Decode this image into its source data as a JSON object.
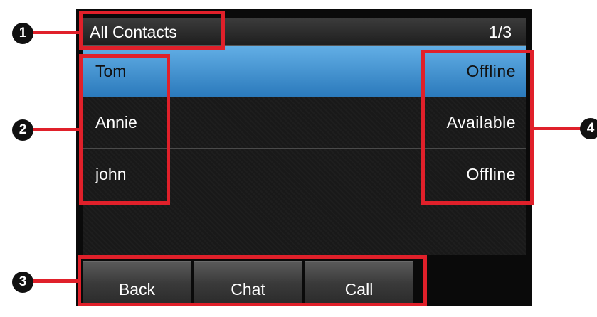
{
  "header": {
    "title": "All Contacts",
    "page_indicator": "1/3"
  },
  "contacts": [
    {
      "name": "Tom",
      "status": "Offline",
      "selected": true
    },
    {
      "name": "Annie",
      "status": "Available",
      "selected": false
    },
    {
      "name": "john",
      "status": "Offline",
      "selected": false
    }
  ],
  "softkeys": {
    "back": "Back",
    "chat": "Chat",
    "call": "Call"
  },
  "annotations": {
    "one": "1",
    "two": "2",
    "three": "3",
    "four": "4"
  },
  "colors": {
    "annotation": "#e0202a",
    "selected_row": "#3d8fd2"
  }
}
